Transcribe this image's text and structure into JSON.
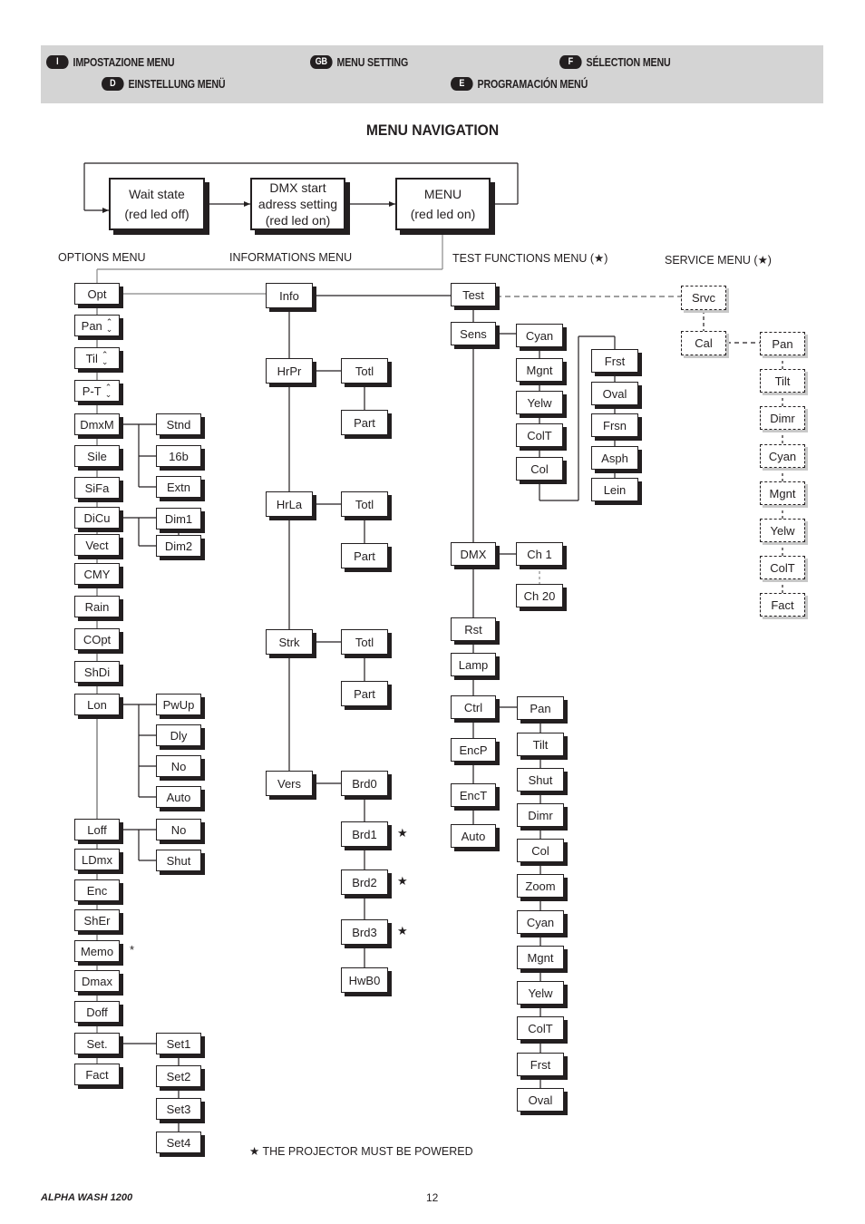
{
  "header": {
    "languages": [
      {
        "code": "I",
        "label": "IMPOSTAZIONE MENU"
      },
      {
        "code": "GB",
        "label": "MENU SETTING"
      },
      {
        "code": "F",
        "label": "SÉLECTION MENU"
      },
      {
        "code": "D",
        "label": "EINSTELLUNG MENÜ"
      },
      {
        "code": "E",
        "label": "PROGRAMACIÓN MENÚ"
      }
    ]
  },
  "title": "MENU NAVIGATION",
  "top_flow": {
    "wait_state": [
      "Wait state",
      "(red led off)"
    ],
    "dmx_start": [
      "DMX start",
      "adress setting",
      "(red led on)"
    ],
    "menu": [
      "MENU",
      "(red led on)"
    ]
  },
  "section_labels": {
    "options": "OPTIONS MENU",
    "informations": "INFORMATIONS MENU",
    "test": "TEST FUNCTIONS MENU (★)",
    "service": "SERVICE MENU (★)"
  },
  "options_menu": {
    "root": "Opt",
    "items": [
      "Pan",
      "Til",
      "P-T",
      "DmxM",
      "Sile",
      "SiFa",
      "DiCu",
      "Vect",
      "CMY",
      "Rain",
      "COpt",
      "ShDi",
      "Lon",
      "Loff",
      "LDmx",
      "Enc",
      "ShEr",
      "Memo",
      "Dmax",
      "Doff",
      "Set.",
      "Fact"
    ],
    "adjustable_items": [
      "Pan",
      "Til",
      "P-T"
    ],
    "submenus": {
      "DmxM": [
        "Stnd",
        "16b",
        "Extn"
      ],
      "DiCu": [
        "Dim1",
        "Dim2"
      ],
      "Lon": [
        "PwUp",
        "Dly",
        "No",
        "Auto"
      ],
      "Loff": [
        "No",
        "Shut"
      ],
      "Set.": [
        "Set1",
        "Set2",
        "Set3",
        "Set4"
      ]
    },
    "memo_marker": "*"
  },
  "informations_menu": {
    "root": "Info",
    "items": [
      "HrPr",
      "HrLa",
      "Strk",
      "Vers"
    ],
    "submenus": {
      "HrPr": [
        "Totl",
        "Part"
      ],
      "HrLa": [
        "Totl",
        "Part"
      ],
      "Strk": [
        "Totl",
        "Part"
      ],
      "Vers": [
        "Brd0",
        "Brd1",
        "Brd2",
        "Brd3",
        "HwB0"
      ]
    },
    "starred": [
      "Brd1",
      "Brd2",
      "Brd3"
    ]
  },
  "test_menu": {
    "root": "Test",
    "items": [
      "Sens",
      "DMX",
      "Rst",
      "Lamp",
      "Ctrl",
      "EncP",
      "EncT",
      "Auto"
    ],
    "submenus": {
      "Sens": [
        "Cyan",
        "Mgnt",
        "Yelw",
        "ColT",
        "Col",
        "Frst",
        "Oval",
        "Frsn",
        "Asph",
        "Lein"
      ],
      "DMX": [
        "Ch 1",
        "Ch 20"
      ],
      "Ctrl": [
        "Pan",
        "Tilt",
        "Shut",
        "Dimr",
        "Col",
        "Zoom",
        "Cyan",
        "Mgnt",
        "Yelw",
        "ColT",
        "Frst",
        "Oval"
      ]
    }
  },
  "service_menu": {
    "root": "Srvc",
    "items": [
      "Cal"
    ],
    "submenus": {
      "Cal": [
        "Pan",
        "Tilt",
        "Dimr",
        "Cyan",
        "Mgnt",
        "Yelw",
        "ColT",
        "Fact"
      ]
    }
  },
  "star_symbol": "★",
  "footnote": "★ THE PROJECTOR MUST BE POWERED",
  "footer": {
    "product": "ALPHA WASH 1200",
    "page": "12"
  }
}
